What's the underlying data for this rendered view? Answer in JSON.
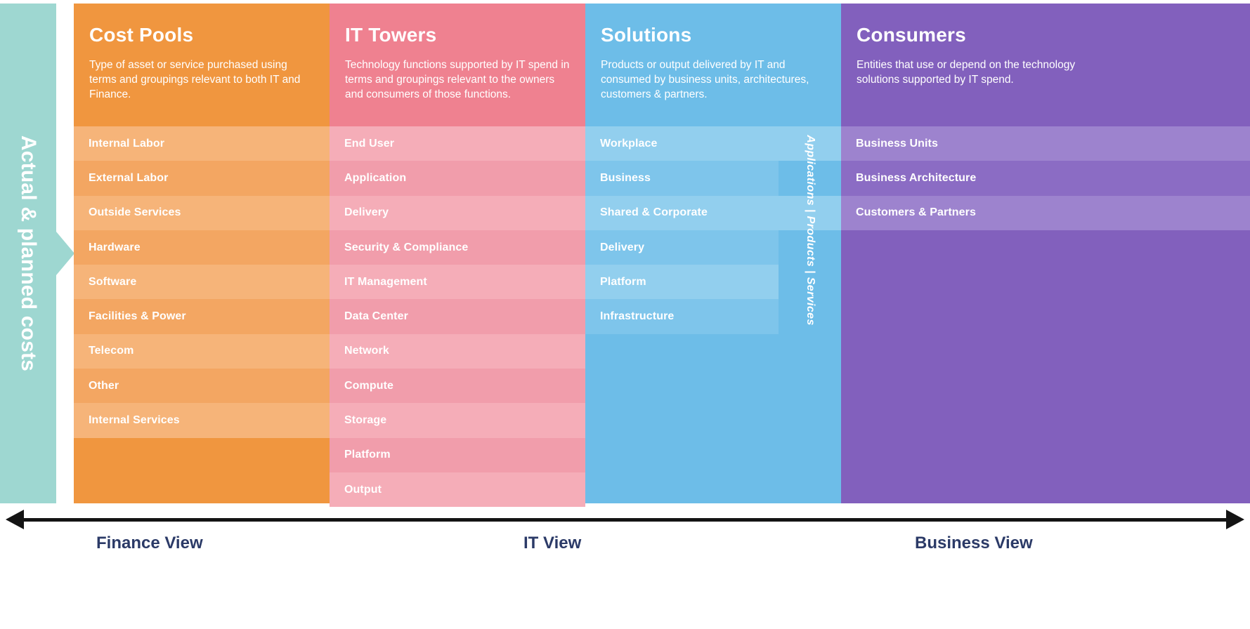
{
  "left_rail": {
    "label": "Actual & planned costs",
    "color": "#9ed7d1"
  },
  "columns": [
    {
      "key": "cost_pools",
      "title": "Cost Pools",
      "description": "Type of asset or service purchased using terms and groupings relevant to both IT and Finance.",
      "color": "#f0963f",
      "items": [
        "Internal Labor",
        "External Labor",
        "Outside Services",
        "Hardware",
        "Software",
        "Facilities & Power",
        "Telecom",
        "Other",
        "Internal Services"
      ]
    },
    {
      "key": "it_towers",
      "title": "IT Towers",
      "description": "Technology functions supported by IT spend in terms and groupings relevant to the owners and consumers of those functions.",
      "color": "#ef8190",
      "items": [
        "End User",
        "Application",
        "Delivery",
        "Security & Compliance",
        "IT Management",
        "Data Center",
        "Network",
        "Compute",
        "Storage",
        "Platform",
        "Output"
      ]
    },
    {
      "key": "solutions",
      "title": "Solutions",
      "description": "Products or output delivered by IT and consumed by business units, architectures, customers & partners.",
      "color": "#6dbde8",
      "vertical_label": "Applications  |  Products  |  Services",
      "items": [
        "Workplace",
        "Business",
        "Shared & Corporate",
        "Delivery",
        "Platform",
        "Infrastructure"
      ]
    },
    {
      "key": "consumers",
      "title": "Consumers",
      "description": "Entities that use or depend on the technology solutions supported by IT spend.",
      "color": "#8260bd",
      "items": [
        "Business Units",
        "Business Architecture",
        "Customers & Partners"
      ]
    }
  ],
  "axis": {
    "labels": [
      "Finance View",
      "IT View",
      "Business View"
    ],
    "color": "#2b3a67"
  }
}
